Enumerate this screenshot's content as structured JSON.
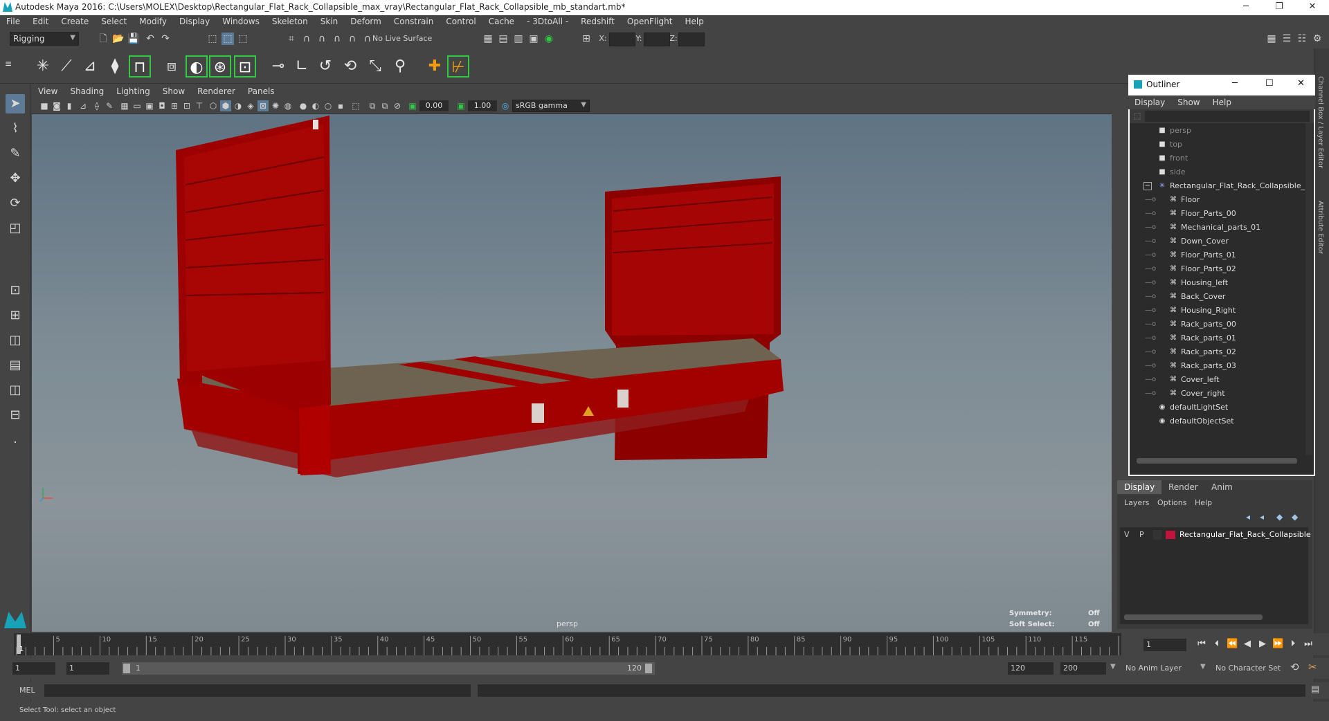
{
  "window": {
    "title": "Autodesk Maya 2016: C:\\Users\\MOLEX\\Desktop\\Rectangular_Flat_Rack_Collapsible_max_vray\\Rectangular_Flat_Rack_Collapsible_mb_standart.mb*",
    "minimize": "─",
    "restore": "❐",
    "close": "✕"
  },
  "menubar": [
    "File",
    "Edit",
    "Create",
    "Select",
    "Modify",
    "Display",
    "Windows",
    "Skeleton",
    "Skin",
    "Deform",
    "Constrain",
    "Control",
    "Cache",
    "- 3DtoAll -",
    "Redshift",
    "OpenFlight",
    "Help"
  ],
  "statusline": {
    "mode": "Rigging",
    "live_surface": "No Live Surface",
    "x_label": "X:",
    "y_label": "Y:",
    "z_label": "Z:"
  },
  "viewport": {
    "menu": [
      "View",
      "Shading",
      "Lighting",
      "Show",
      "Renderer",
      "Panels"
    ],
    "exposure": "0.00",
    "gamma": "1.00",
    "colorspace": "sRGB gamma",
    "camera_label": "persp",
    "hud": {
      "symmetry_label": "Symmetry:",
      "symmetry_value": "Off",
      "soft_label": "Soft Select:",
      "soft_value": "Off"
    },
    "colors": {
      "rack_red": "#a30000",
      "floor_wood": "#6e6250"
    }
  },
  "outliner": {
    "title": "Outliner",
    "menu": [
      "Display",
      "Show",
      "Help"
    ],
    "cameras": [
      "persp",
      "top",
      "front",
      "side"
    ],
    "root": "Rectangular_Flat_Rack_Collapsible_n",
    "children": [
      "Floor",
      "Floor_Parts_00",
      "Mechanical_parts_01",
      "Down_Cover",
      "Floor_Parts_01",
      "Floor_Parts_02",
      "Housing_left",
      "Back_Cover",
      "Housing_Right",
      "Rack_parts_00",
      "Rack_parts_01",
      "Rack_parts_02",
      "Rack_parts_03",
      "Cover_left",
      "Cover_right"
    ],
    "sets": [
      "defaultLightSet",
      "defaultObjectSet"
    ]
  },
  "layer_editor": {
    "tabs": [
      "Display",
      "Render",
      "Anim"
    ],
    "menu": [
      "Layers",
      "Options",
      "Help"
    ],
    "layer": {
      "v": "V",
      "p": "P",
      "name": "Rectangular_Flat_Rack_Collapsible",
      "color": "#c0143c"
    }
  },
  "right_tabs": [
    "Channel Box / Layer Editor",
    "Attribute Editor"
  ],
  "timeline": {
    "ticks": [
      "5",
      "10",
      "15",
      "20",
      "25",
      "30",
      "35",
      "40",
      "45",
      "50",
      "55",
      "60",
      "65",
      "70",
      "75",
      "80",
      "85",
      "90",
      "95",
      "100",
      "105",
      "110",
      "115",
      "120"
    ],
    "first": "1",
    "current_frame": "1"
  },
  "range": {
    "start": "1",
    "playback_start": "1",
    "slider_start": "1",
    "slider_end": "120",
    "playback_end": "120",
    "end": "200",
    "anim_layer": "No Anim Layer",
    "character_set": "No Character Set"
  },
  "cmdline": {
    "label": "MEL"
  },
  "helpline": {
    "text": "Select Tool: select an object"
  }
}
